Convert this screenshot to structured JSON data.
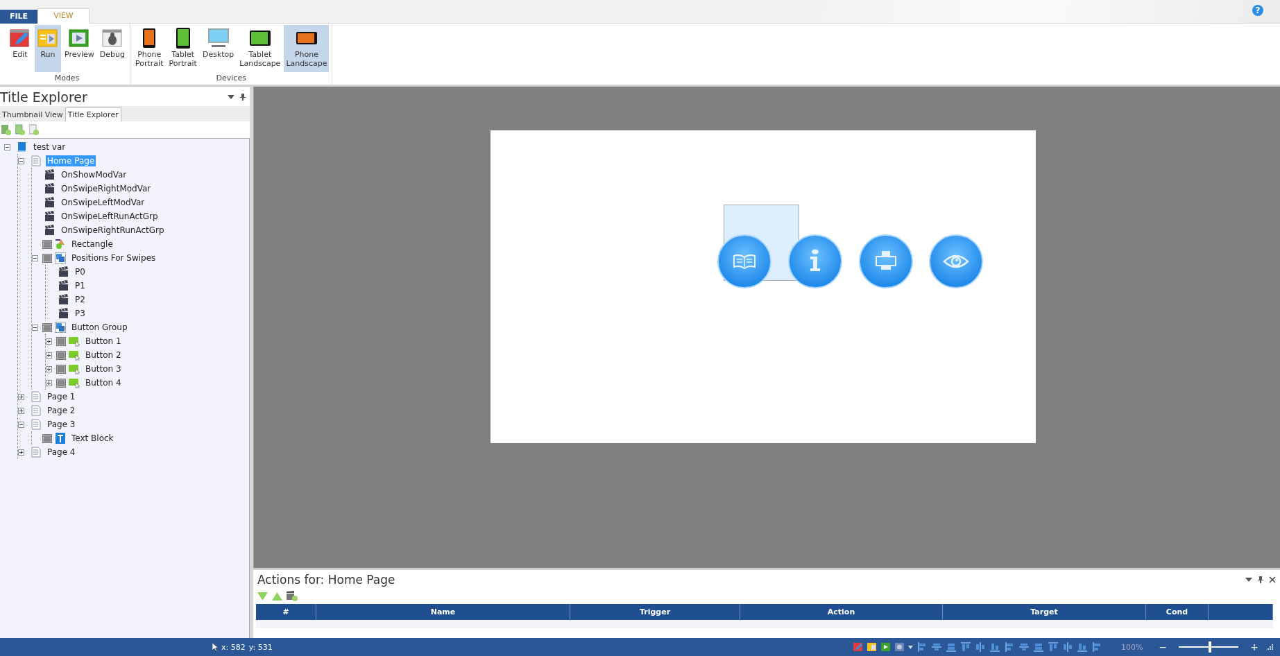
{
  "ribbon": {
    "tabs": [
      {
        "label": "FILE",
        "kind": "file",
        "selected": false
      },
      {
        "label": "VIEW",
        "kind": "normal",
        "selected": true
      }
    ],
    "help": "?",
    "groups": [
      {
        "label": "Modes",
        "buttons": [
          {
            "label": "Edit",
            "kind": "edit",
            "selected": false
          },
          {
            "label": "Run",
            "kind": "run",
            "selected": true
          },
          {
            "label": "Preview",
            "kind": "preview",
            "selected": false
          },
          {
            "label": "Debug",
            "kind": "debug",
            "selected": false
          }
        ]
      },
      {
        "label": "Devices",
        "buttons": [
          {
            "label": "Phone\nPortrait",
            "kind": "phoneportrait",
            "selected": false
          },
          {
            "label": "Tablet\nPortrait",
            "kind": "tabletportrait",
            "selected": false
          },
          {
            "label": "Desktop",
            "kind": "desktop",
            "selected": false
          },
          {
            "label": "Tablet\nLandscape",
            "kind": "tabletlandscape",
            "selected": false
          },
          {
            "label": "Phone\nLandscape",
            "kind": "phonelandscape",
            "selected": true
          }
        ]
      }
    ]
  },
  "explorer": {
    "title": "Title Explorer",
    "tabs": [
      {
        "label": "Thumbnail View",
        "selected": false
      },
      {
        "label": "Title Explorer",
        "selected": true
      }
    ],
    "tree": [
      {
        "label": "test var",
        "kind": "book",
        "expanded": true,
        "selected": false,
        "children": [
          {
            "label": "Home Page",
            "kind": "page",
            "expanded": true,
            "selected": true,
            "children": [
              {
                "label": "OnShowModVar",
                "kind": "action",
                "selected": false
              },
              {
                "label": "OnSwipeRightModVar",
                "kind": "action",
                "selected": false
              },
              {
                "label": "OnSwipeLeftModVar",
                "kind": "action",
                "selected": false
              },
              {
                "label": "OnSwipeLeftRunActGrp",
                "kind": "action",
                "selected": false
              },
              {
                "label": "OnSwipeRightRunActGrp",
                "kind": "action",
                "selected": false
              },
              {
                "label": "Rectangle",
                "kind": "shape",
                "selected": false
              },
              {
                "label": "Positions For Swipes",
                "kind": "group",
                "expanded": true,
                "selected": false,
                "children": [
                  {
                    "label": "P0",
                    "kind": "action",
                    "selected": false
                  },
                  {
                    "label": "P1",
                    "kind": "action",
                    "selected": false
                  },
                  {
                    "label": "P2",
                    "kind": "action",
                    "selected": false
                  },
                  {
                    "label": "P3",
                    "kind": "action",
                    "selected": false
                  }
                ]
              },
              {
                "label": "Button Group",
                "kind": "group",
                "expanded": true,
                "selected": false,
                "children": [
                  {
                    "label": "Button 1",
                    "kind": "button",
                    "expanded": false,
                    "selected": false
                  },
                  {
                    "label": "Button 2",
                    "kind": "button",
                    "expanded": false,
                    "selected": false
                  },
                  {
                    "label": "Button 3",
                    "kind": "button",
                    "expanded": false,
                    "selected": false
                  },
                  {
                    "label": "Button 4",
                    "kind": "button",
                    "expanded": false,
                    "selected": false
                  }
                ]
              }
            ]
          },
          {
            "label": "Page 1",
            "kind": "page",
            "expanded": false,
            "selected": false
          },
          {
            "label": "Page 2",
            "kind": "page",
            "expanded": false,
            "selected": false
          },
          {
            "label": "Page 3",
            "kind": "page",
            "expanded": true,
            "selected": false,
            "children": [
              {
                "label": "Text Block",
                "kind": "text",
                "selected": false
              }
            ]
          },
          {
            "label": "Page 4",
            "kind": "page",
            "expanded": false,
            "selected": false
          }
        ]
      }
    ]
  },
  "stage": {
    "buttons": [
      {
        "kind": "book"
      },
      {
        "kind": "info"
      },
      {
        "kind": "printer"
      },
      {
        "kind": "eye"
      }
    ]
  },
  "actions": {
    "title": "Actions for: Home Page",
    "columns": [
      "#",
      "Name",
      "Trigger",
      "Action",
      "Target",
      "Cond"
    ]
  },
  "status_bar": {
    "x": "x: 582",
    "y": "y: 531",
    "zoom": "100%",
    "minus": "−",
    "plus": "+",
    "zoom_slider": {
      "level": 0.52
    }
  }
}
